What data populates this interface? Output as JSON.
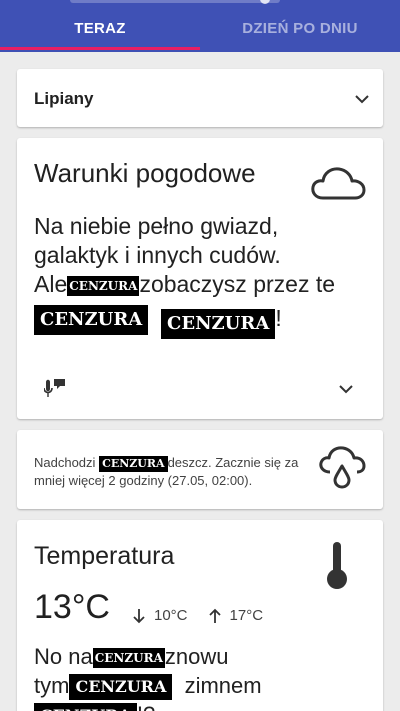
{
  "tabs": [
    {
      "label": "TERAZ",
      "active": true
    },
    {
      "label": "DZIEŃ PO DNIU",
      "active": false
    }
  ],
  "colors": {
    "app_bar": "#3f51b5",
    "tab_indicator": "#e91e63",
    "background": "#ececec"
  },
  "location": {
    "selected": "Lipiany"
  },
  "conditions": {
    "title": "Warunki pogodowe",
    "icon": "cloud-icon",
    "line1": "Na niebie pełno gwiazd,",
    "line2": "galaktyk i innych cudów.",
    "line3_a": "Ale",
    "line3_b": "zobaczysz przez te",
    "line4_end": "!",
    "censor": "CENZURA",
    "action_icons": [
      "microphone-chat-icon",
      "chevron-down-icon"
    ]
  },
  "rain": {
    "text_a": "Nadchodzi",
    "text_b": "deszcz. Zacznie się",
    "text_c": "za mniej więcej 2 godziny (27.05, 02:00).",
    "censor": "CENZURA",
    "icon": "rain-cloud-icon"
  },
  "temperature": {
    "title": "Temperatura",
    "icon": "thermometer-icon",
    "current": "13°C",
    "min": "10°C",
    "max": "17°C",
    "text_a": "No na",
    "text_b": "znowu",
    "text_c": "tym",
    "text_d": "zimnem",
    "text_e": "!?",
    "censor": "CENZURA"
  }
}
